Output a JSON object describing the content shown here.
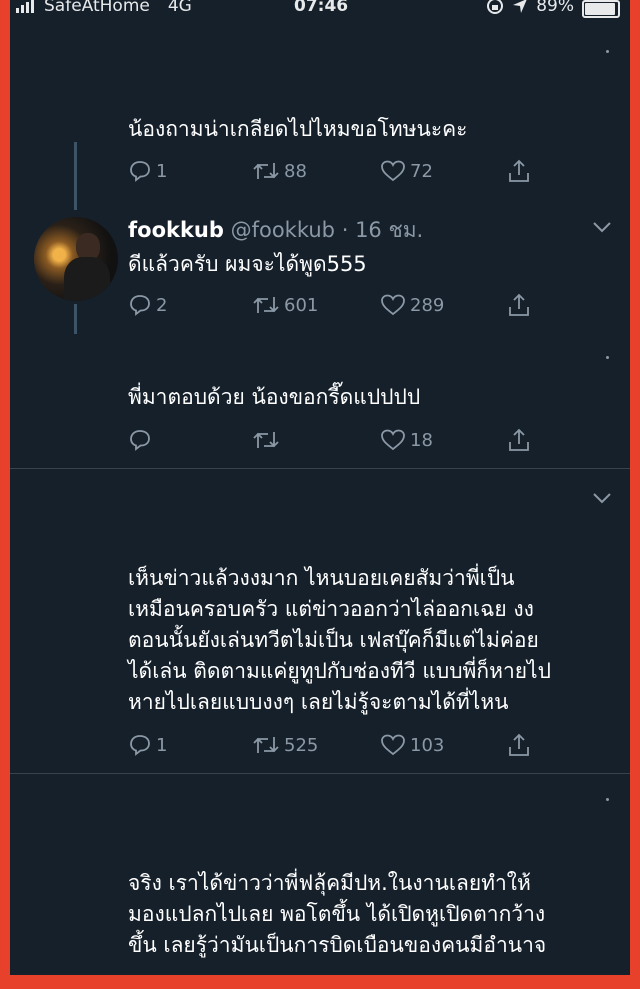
{
  "status_bar": {
    "carrier": "SafeAtHome",
    "network": "4G",
    "time": "07:46",
    "battery": "89%",
    "battery_level": 0.89
  },
  "colors": {
    "background": "#15202b",
    "frame": "#e8412b",
    "text": "#ffffff",
    "secondary": "#8b98a5"
  },
  "tweets": [
    {
      "text": "น้องถามน่าเกลียดไปไหมขอโทษนะคะ",
      "replies": "1",
      "retweets": "88",
      "likes": "72"
    },
    {
      "author_name": "fookkub",
      "author_handle": "@fookkub",
      "separator": "·",
      "time": "16 ชม.",
      "text": "ดีแล้วครับ ผมจะได้พูด555",
      "replies": "2",
      "retweets": "601",
      "likes": "289"
    },
    {
      "text": "พี่มาตอบด้วย น้องขอกรี๊ดแปปปป",
      "replies": "",
      "retweets": "",
      "likes": "18"
    },
    {
      "text": "เห็นข่าวแล้วงงมาก ไหนบอยเคยสัมว่าพี่เป็น\nเหมือนครอบครัว แต่ข่าวออกว่าไล่ออกเฉย งง\nตอนนั้นยังเล่นทวีตไม่เป็น เฟสบุ๊คก็มีแต่ไม่ค่อย\nได้เล่น ติดตามแค่ยูทูปกับช่องทีวี แบบพี่ก็หายไป\nหายไปเลยแบบงงๆ เลยไม่รู้จะตามได้ที่ไหน",
      "replies": "1",
      "retweets": "525",
      "likes": "103"
    },
    {
      "text": "จริง เราได้ข่าวว่าพี่ฟลุ้คมีปห.ในงานเลยทำให้\nมองแปลกไปเลย พอโตขึ้น ได้เปิดหูเปิดตากว้าง\nขึ้น เลยรู้ว่ามันเป็นการบิดเบือนของคนมีอำนาจ"
    }
  ]
}
